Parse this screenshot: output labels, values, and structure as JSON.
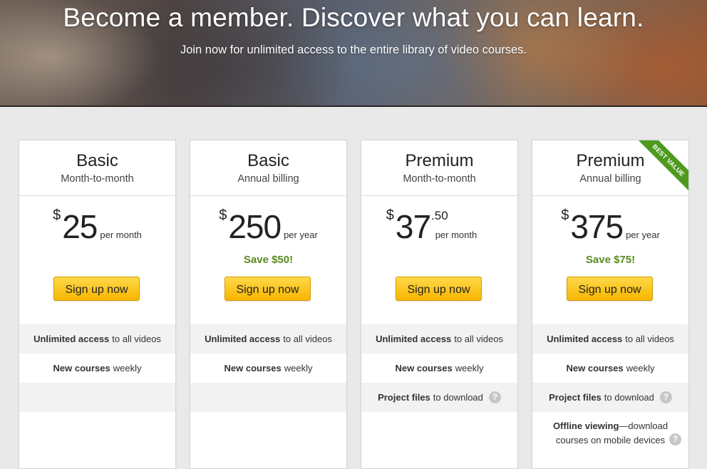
{
  "hero": {
    "title": "Become a member. Discover what you can learn.",
    "subtitle": "Join now for unlimited access to the entire library of video courses."
  },
  "plans": [
    {
      "name": "Basic",
      "billing": "Month-to-month",
      "currency": "$",
      "amount": "25",
      "cents": "",
      "period": "per month",
      "save": "",
      "button": "Sign up now"
    },
    {
      "name": "Basic",
      "billing": "Annual billing",
      "currency": "$",
      "amount": "250",
      "cents": "",
      "period": "per year",
      "save": "Save $50!",
      "button": "Sign up now"
    },
    {
      "name": "Premium",
      "billing": "Month-to-month",
      "currency": "$",
      "amount": "37",
      "cents": ".50",
      "period": "per month",
      "save": "",
      "button": "Sign up now"
    },
    {
      "name": "Premium",
      "billing": "Annual billing",
      "currency": "$",
      "amount": "375",
      "cents": "",
      "period": "per year",
      "save": "Save $75!",
      "button": "Sign up now",
      "badge": "BEST VALUE"
    }
  ],
  "features": {
    "unlimited_bold": "Unlimited access",
    "unlimited_rest": "to all videos",
    "courses_bold": "New courses",
    "courses_rest": "weekly",
    "project_bold": "Project files",
    "project_rest": "to download",
    "offline_bold": "Offline viewing",
    "offline_rest": "—download",
    "offline_line2": "courses on mobile devices",
    "help_glyph": "?"
  },
  "colors": {
    "accent_green": "#5b8a23",
    "button_yellow": "#f7b500",
    "ribbon_green": "#4d9a1f"
  }
}
